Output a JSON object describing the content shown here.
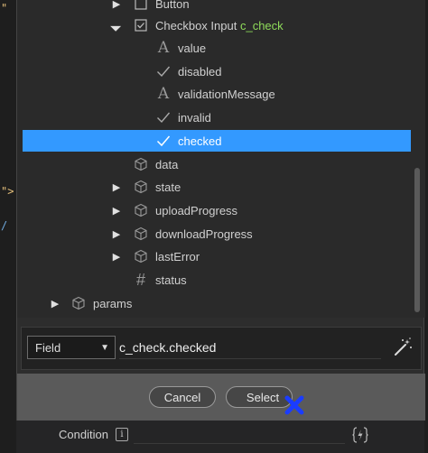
{
  "editor_fragments": [
    "\"",
    "\">",
    "/"
  ],
  "tree": {
    "items": [
      {
        "label": "Button",
        "label_accent": "",
        "icon": "checkbox-icon",
        "arrow": "right"
      },
      {
        "label": "Checkbox Input",
        "label_accent": "c_check",
        "icon": "checkbox-icon",
        "arrow": "down"
      },
      {
        "label": "value",
        "icon": "text-type-icon"
      },
      {
        "label": "disabled",
        "icon": "boolean-check-icon"
      },
      {
        "label": "validationMessage",
        "icon": "text-type-icon"
      },
      {
        "label": "invalid",
        "icon": "boolean-check-icon"
      },
      {
        "label": "checked",
        "icon": "boolean-check-icon",
        "selected": true
      },
      {
        "label": "data",
        "icon": "cube-icon"
      },
      {
        "label": "state",
        "icon": "cube-icon",
        "arrow": "right"
      },
      {
        "label": "uploadProgress",
        "icon": "cube-icon",
        "arrow": "right"
      },
      {
        "label": "downloadProgress",
        "icon": "cube-icon",
        "arrow": "right"
      },
      {
        "label": "lastError",
        "icon": "cube-icon",
        "arrow": "right"
      },
      {
        "label": "status",
        "icon": "hash-icon"
      },
      {
        "label": "params",
        "icon": "cube-icon",
        "arrow": "right"
      }
    ]
  },
  "field_bar": {
    "type_selected": "Field",
    "expression": "c_check.checked"
  },
  "footer": {
    "cancel_label": "Cancel",
    "select_label": "Select"
  },
  "condition": {
    "label": "Condition",
    "info": "i"
  },
  "colors": {
    "selection": "#3399ff",
    "accent_green": "#8fdc5a",
    "cursor_blue": "#1a3cff"
  }
}
